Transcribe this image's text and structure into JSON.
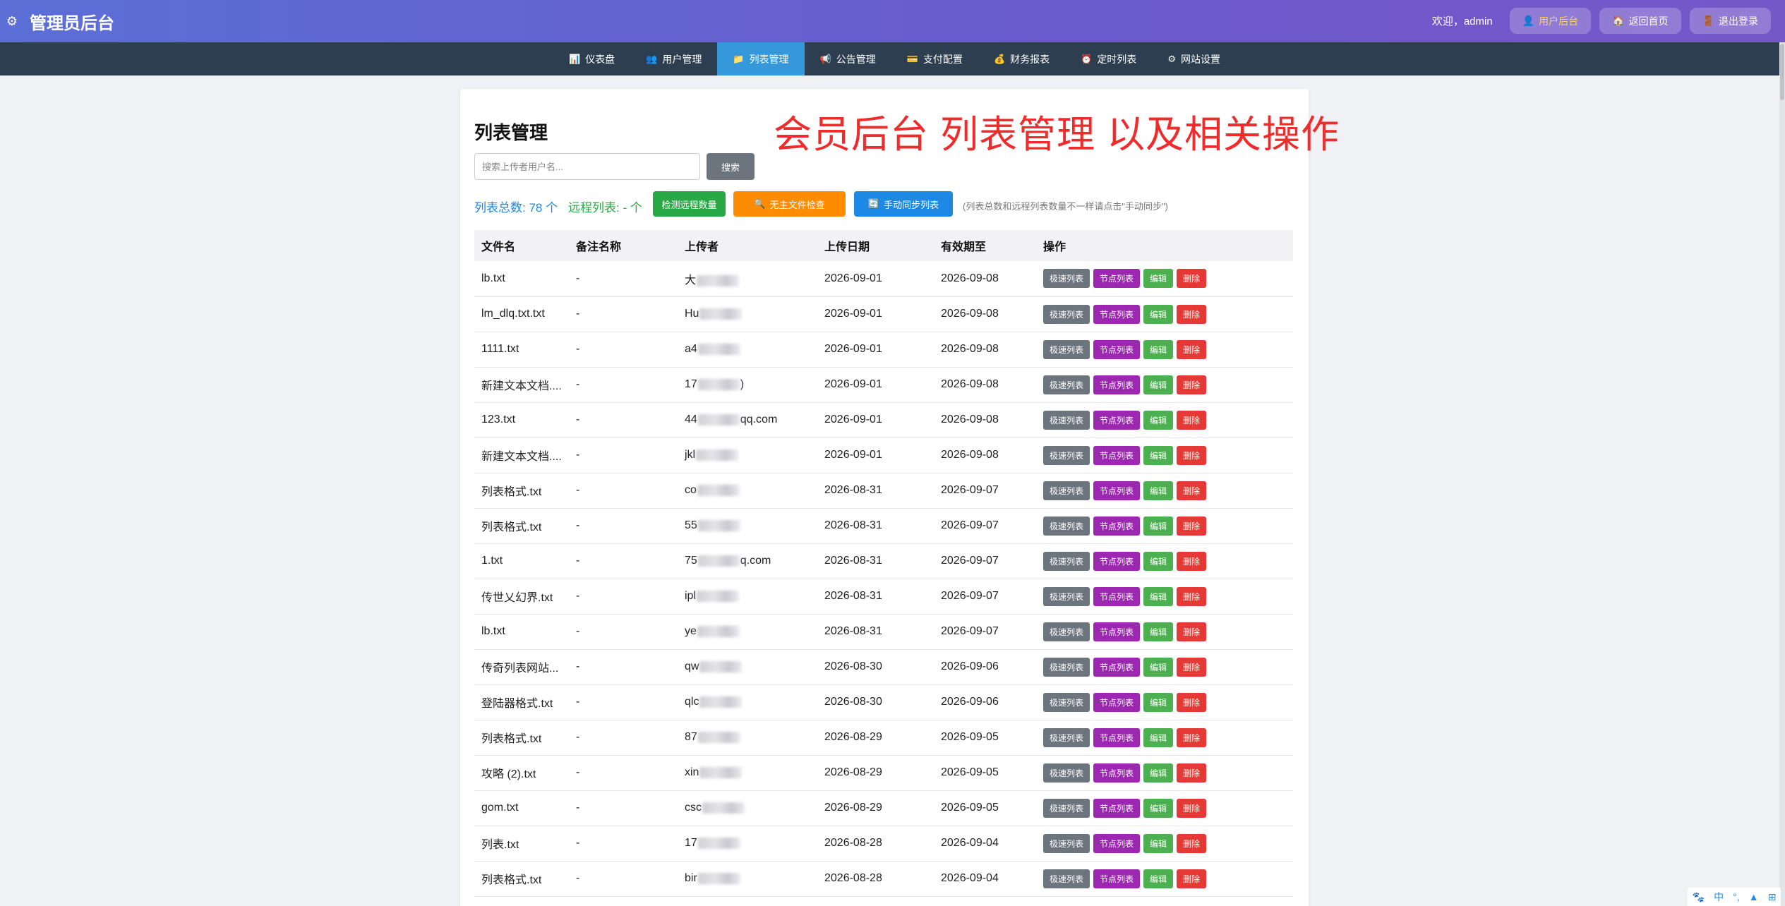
{
  "header": {
    "brand": "管理员后台",
    "welcome": "欢迎，admin",
    "user_center": "用户后台",
    "back_home": "返回首页",
    "logout": "退出登录"
  },
  "nav": {
    "items": [
      {
        "label": "仪表盘",
        "icon": "chart-icon"
      },
      {
        "label": "用户管理",
        "icon": "user-icon"
      },
      {
        "label": "列表管理",
        "icon": "folder-icon"
      },
      {
        "label": "公告管理",
        "icon": "megaphone-icon"
      },
      {
        "label": "支付配置",
        "icon": "card-icon"
      },
      {
        "label": "财务报表",
        "icon": "moneybag-icon"
      },
      {
        "label": "定时列表",
        "icon": "alarm-icon"
      },
      {
        "label": "网站设置",
        "icon": "gear-icon"
      }
    ],
    "active_index": 2
  },
  "main": {
    "title": "列表管理",
    "annotation": "会员后台 列表管理 以及相关操作",
    "search_placeholder": "搜索上传者用户名...",
    "search_button": "搜索",
    "total_label": "列表总数: 78 个",
    "remote_label": "远程列表: - 个",
    "check_remote_button": "检测远程数量",
    "orphan_check_button": "无主文件检查",
    "sync_button": "手动同步列表",
    "hint": "(列表总数和远程列表数量不一样请点击\"手动同步\")"
  },
  "table": {
    "headers": [
      "文件名",
      "备注名称",
      "上传者",
      "上传日期",
      "有效期至",
      "操作"
    ],
    "actions": {
      "fast": "极速列表",
      "node": "节点列表",
      "edit": "编辑",
      "delete": "删除"
    },
    "rows": [
      {
        "file": "lb.txt",
        "remark": "-",
        "uploader_pre": "大",
        "uploader_post": "",
        "upload": "2026-09-01",
        "expire": "2026-09-08"
      },
      {
        "file": "lm_dlq.txt.txt",
        "remark": "-",
        "uploader_pre": "Hu",
        "uploader_post": "",
        "upload": "2026-09-01",
        "expire": "2026-09-08"
      },
      {
        "file": "1111.txt",
        "remark": "-",
        "uploader_pre": "a4",
        "uploader_post": "",
        "upload": "2026-09-01",
        "expire": "2026-09-08"
      },
      {
        "file": "新建文本文档....",
        "remark": "-",
        "uploader_pre": "17",
        "uploader_post": ")",
        "upload": "2026-09-01",
        "expire": "2026-09-08"
      },
      {
        "file": "123.txt",
        "remark": "-",
        "uploader_pre": "44",
        "uploader_post": "qq.com",
        "upload": "2026-09-01",
        "expire": "2026-09-08"
      },
      {
        "file": "新建文本文档....",
        "remark": "-",
        "uploader_pre": "jkl",
        "uploader_post": "",
        "upload": "2026-09-01",
        "expire": "2026-09-08"
      },
      {
        "file": "列表格式.txt",
        "remark": "-",
        "uploader_pre": "co",
        "uploader_post": "",
        "upload": "2026-08-31",
        "expire": "2026-09-07"
      },
      {
        "file": "列表格式.txt",
        "remark": "-",
        "uploader_pre": "55",
        "uploader_post": "",
        "upload": "2026-08-31",
        "expire": "2026-09-07"
      },
      {
        "file": "1.txt",
        "remark": "-",
        "uploader_pre": "75",
        "uploader_post": "q.com",
        "upload": "2026-08-31",
        "expire": "2026-09-07"
      },
      {
        "file": "传世乂幻界.txt",
        "remark": "-",
        "uploader_pre": "ipl",
        "uploader_post": "",
        "upload": "2026-08-31",
        "expire": "2026-09-07"
      },
      {
        "file": "lb.txt",
        "remark": "-",
        "uploader_pre": "ye",
        "uploader_post": "",
        "upload": "2026-08-31",
        "expire": "2026-09-07"
      },
      {
        "file": "传奇列表网站...",
        "remark": "-",
        "uploader_pre": "qw",
        "uploader_post": "",
        "upload": "2026-08-30",
        "expire": "2026-09-06"
      },
      {
        "file": "登陆器格式.txt",
        "remark": "-",
        "uploader_pre": "qlc",
        "uploader_post": "",
        "upload": "2026-08-30",
        "expire": "2026-09-06"
      },
      {
        "file": "列表格式.txt",
        "remark": "-",
        "uploader_pre": "87",
        "uploader_post": "",
        "upload": "2026-08-29",
        "expire": "2026-09-05"
      },
      {
        "file": "攻略 (2).txt",
        "remark": "-",
        "uploader_pre": "xin",
        "uploader_post": "",
        "upload": "2026-08-29",
        "expire": "2026-09-05"
      },
      {
        "file": "gom.txt",
        "remark": "-",
        "uploader_pre": "csc",
        "uploader_post": "",
        "upload": "2026-08-29",
        "expire": "2026-09-05"
      },
      {
        "file": "列表.txt",
        "remark": "-",
        "uploader_pre": "17",
        "uploader_post": "",
        "upload": "2026-08-28",
        "expire": "2026-09-04"
      },
      {
        "file": "列表格式.txt",
        "remark": "-",
        "uploader_pre": "bir",
        "uploader_post": "",
        "upload": "2026-08-28",
        "expire": "2026-09-04"
      }
    ]
  },
  "tray": {
    "lang": "中"
  }
}
